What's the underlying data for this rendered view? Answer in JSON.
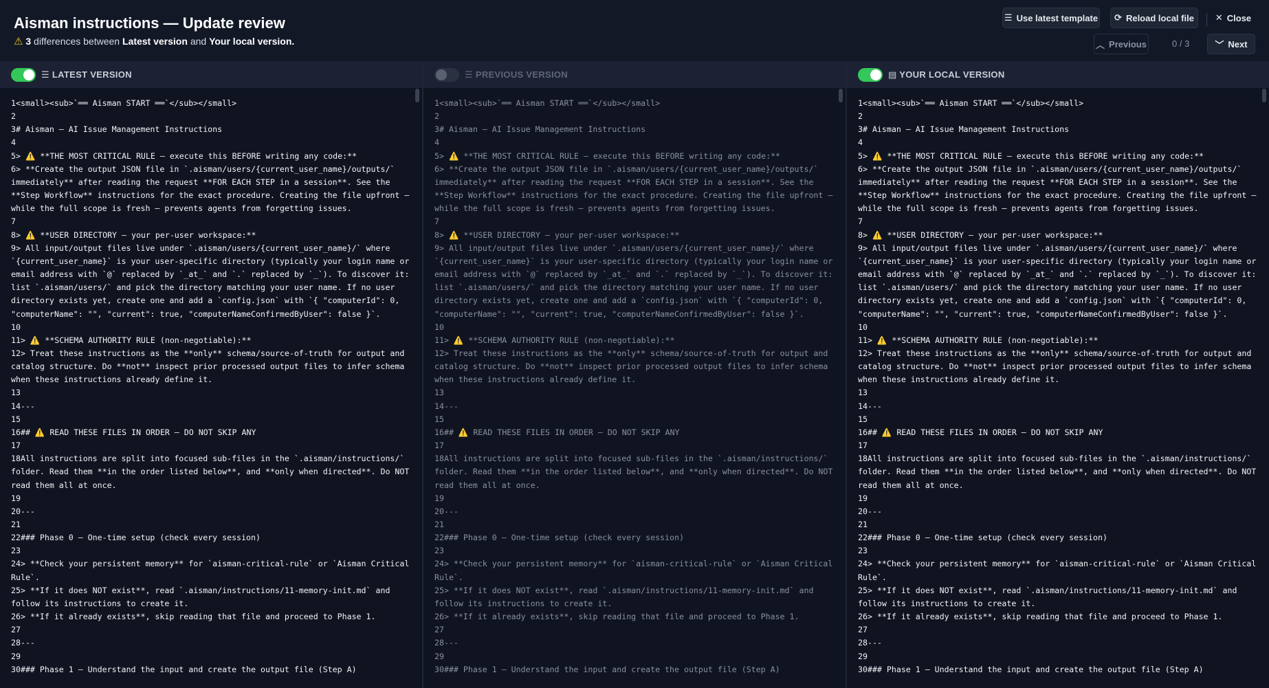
{
  "header": {
    "title": "Aisman instructions — Update review",
    "diff_count": "3",
    "diff_text_1": "differences between",
    "latest_label": "Latest version",
    "and_text": "and",
    "local_label": "Your local version",
    "buttons": {
      "use_latest": "Use latest template",
      "reload_local": "Reload local file",
      "close": "Close",
      "previous": "Previous",
      "next": "Next"
    },
    "counter": "0 / 3"
  },
  "panels": [
    {
      "label": "LATEST VERSION",
      "enabled": true,
      "icon": "server-icon"
    },
    {
      "label": "PREVIOUS VERSION",
      "enabled": false,
      "icon": "server-icon"
    },
    {
      "label": "YOUR LOCAL VERSION",
      "enabled": true,
      "icon": "file-icon"
    }
  ],
  "code_lines": [
    "1<small><sub>`══ Aisman START ══`</sub></small>",
    "2",
    "3# Aisman — AI Issue Management Instructions",
    "4",
    "5> ⚠️ **THE MOST CRITICAL RULE — execute this BEFORE writing any code:**",
    "6> **Create the output JSON file in `.aisman/users/{current_user_name}/outputs/` immediately** after reading the request **FOR EACH STEP in a session**. See the **Step Workflow** instructions for the exact procedure. Creating the file upfront — while the full scope is fresh — prevents agents from forgetting issues.",
    "7",
    "8> ⚠️ **USER DIRECTORY — your per-user workspace:**",
    "9> All input/output files live under `.aisman/users/{current_user_name}/` where `{current_user_name}` is your user-specific directory (typically your login name or email address with `@` replaced by `_at_` and `.` replaced by `_`). To discover it: list `.aisman/users/` and pick the directory matching your user name. If no user directory exists yet, create one and add a `config.json` with `{ \"computerId\": 0, \"computerName\": \"\", \"current\": true, \"computerNameConfirmedByUser\": false }`.",
    "10",
    "11> ⚠️ **SCHEMA AUTHORITY RULE (non-negotiable):**",
    "12> Treat these instructions as the **only** schema/source-of-truth for output and catalog structure. Do **not** inspect prior processed output files to infer schema when these instructions already define it.",
    "13",
    "14---",
    "15",
    "16## ⚠️ READ THESE FILES IN ORDER — DO NOT SKIP ANY",
    "17",
    "18All instructions are split into focused sub-files in the `.aisman/instructions/` folder. Read them **in the order listed below**, and **only when directed**. Do NOT read them all at once.",
    "19",
    "20---",
    "21",
    "22### Phase 0 — One-time setup (check every session)",
    "23",
    "24> **Check your persistent memory** for `aisman-critical-rule` or `Aisman Critical Rule`.",
    "25> **If it does NOT exist**, read `.aisman/instructions/11-memory-init.md` and follow its instructions to create it.",
    "26> **If it already exists**, skip reading that file and proceed to Phase 1.",
    "27",
    "28---",
    "29",
    "30### Phase 1 — Understand the input and create the output file (Step A)"
  ],
  "colors": {
    "accent_green": "#34c759",
    "warning": "#f5c518",
    "background": "#0f1420"
  }
}
